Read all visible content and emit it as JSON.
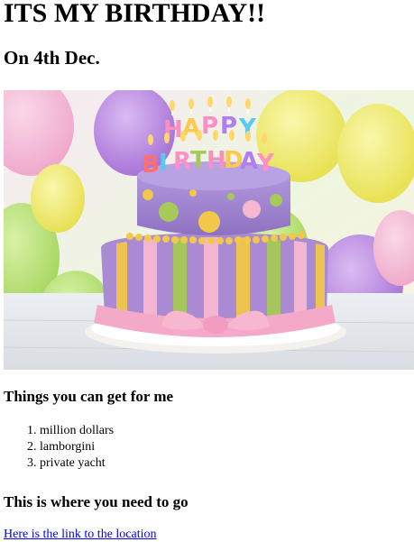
{
  "heading": "ITS MY BIRTHDAY!!",
  "subheading": "On 4th Dec.",
  "image": {
    "cake_text": "HAPPY BIRTHDAY",
    "colors": {
      "cake_top": "#9b7fc9",
      "cake_bottom": "#a98ad3",
      "frosting_pink": "#f7b8cf",
      "dots_green": "#a7c957",
      "dots_yellow": "#f2c84b",
      "balloon_purple": "#b37ee0",
      "balloon_yellow": "#f3ee5e",
      "balloon_green": "#a8e063"
    }
  },
  "gifts": {
    "title": "Things you can get for me",
    "items": [
      "million dollars",
      "lamborgini",
      "private yacht"
    ]
  },
  "location": {
    "title": "This is where you need to go",
    "link_text": "Here is the link to the location"
  }
}
